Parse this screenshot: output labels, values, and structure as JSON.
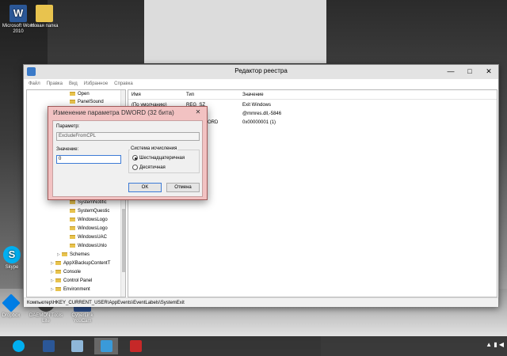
{
  "desktop": {
    "icons": [
      {
        "label": "Microsoft Word 2010",
        "icon": "word-icon",
        "color": "#2b5797"
      },
      {
        "label": "Новая папка",
        "icon": "folder-icon",
        "color": "#e8c34e"
      },
      {
        "label": "Skype",
        "icon": "skype-icon",
        "color": "#00aff0"
      },
      {
        "label": "Dropbox",
        "icon": "dropbox-icon",
        "color": "#007ee5"
      },
      {
        "label": "DAEMON Tools Lite",
        "icon": "daemon-tools-icon",
        "color": "#444444"
      },
      {
        "label": "CyberLink YouCam",
        "icon": "youcam-icon",
        "color": "#2c4f8c"
      }
    ]
  },
  "window": {
    "title": "Редактор реестра",
    "controls": {
      "minimize": "—",
      "maximize": "□",
      "close": "✕"
    },
    "menu": [
      "Файл",
      "Правка",
      "Вид",
      "Избранное",
      "Справка"
    ],
    "tree_items": [
      "Open",
      "PanelSound",
      "SystemNotific",
      "SystemQuestic",
      "WindowsLogo",
      "WindowsLogo",
      "WindowsUAC",
      "WindowsUnlo",
      "Schemes",
      "AppXBackupContentT",
      "Console",
      "Control Panel",
      "Environment"
    ],
    "list_headers": {
      "name": "Имя",
      "type": "Тип",
      "value": "Значение"
    },
    "list_rows": [
      {
        "name": "(По умолчанию)",
        "type": "REG_SZ",
        "value": "Exit Windows"
      },
      {
        "name": "",
        "type": "",
        "value": "@mmres.dll,-5846"
      },
      {
        "name": "",
        "type": "ORD",
        "value": "0x00000001 (1)"
      }
    ],
    "status_path": "Компьютер\\HKEY_CURRENT_USER\\AppEvents\\EventLabels\\SystemExit"
  },
  "dialog": {
    "title": "Изменение параметра DWORD (32 бита)",
    "close": "✕",
    "param_label": "Параметр:",
    "param_value": "ExcludeFromCPL",
    "value_label": "Значение:",
    "value": "0",
    "base_label": "Система исчисления",
    "base_options": [
      "Шестнадцатеричная",
      "Десятичная"
    ],
    "selected_base": "Шестнадцатеричная",
    "ok": "OK",
    "cancel": "Отмена",
    "accent": "#f2c2c2"
  },
  "taskbar": {
    "apps": [
      {
        "icon": "skype-icon",
        "color": "#00aff0"
      },
      {
        "icon": "word-icon",
        "color": "#2b5797"
      },
      {
        "icon": "explorer-icon",
        "color": "#8fb7d9"
      },
      {
        "icon": "registry-editor-icon",
        "color": "#3a9ad9"
      },
      {
        "icon": "acrobat-icon",
        "color": "#c62828"
      }
    ],
    "tray": "▲ ▮ ◀"
  }
}
